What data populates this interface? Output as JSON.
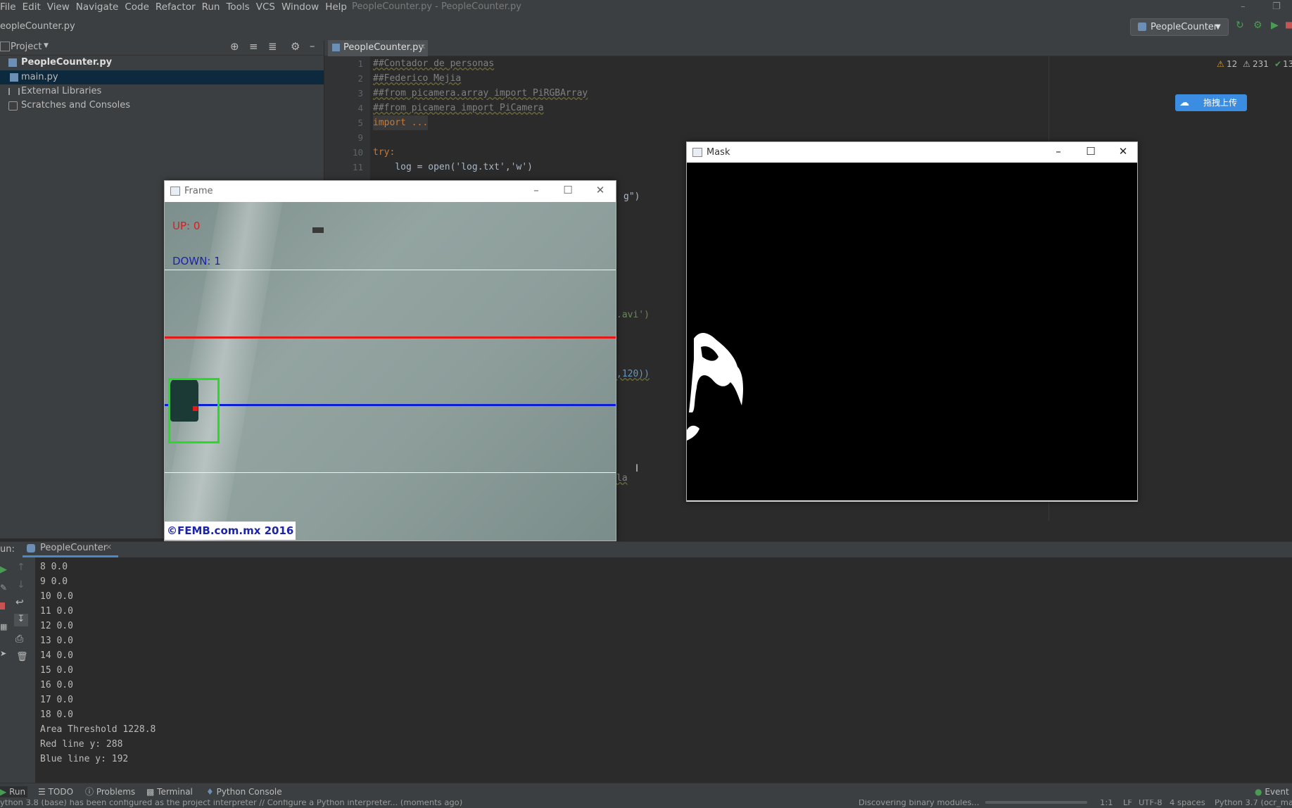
{
  "menu": [
    "File",
    "Edit",
    "View",
    "Navigate",
    "Code",
    "Refactor",
    "Run",
    "Tools",
    "VCS",
    "Window",
    "Help"
  ],
  "window_title": "PeopleCounter.py - PeopleCounter.py",
  "nav_file": "eopleCounter.py",
  "run_config": "PeopleCounter",
  "project": {
    "header": "Project",
    "items": [
      {
        "label": "PeopleCounter.py"
      },
      {
        "label": "main.py"
      },
      {
        "label": "External Libraries"
      },
      {
        "label": "Scratches and Consoles"
      }
    ]
  },
  "editor": {
    "tab": "PeopleCounter.py",
    "inspections": {
      "warnings": "12",
      "weak_warnings": "231",
      "ok": "13"
    },
    "line_numbers": [
      "1",
      "2",
      "3",
      "4",
      "5",
      "9",
      "10",
      "11"
    ],
    "lines": [
      "##Contador de personas",
      "##Federico Mejia",
      "##from picamera.array import PiRGBArray",
      "##from picamera import PiCamera",
      "import ...",
      "",
      "try:",
      "    log = open('log.txt','w')"
    ],
    "peek_fragments": [
      "g\")",
      ".avi')",
      ",120))",
      "la"
    ],
    "upload_badge": "拖拽上传"
  },
  "frame_window": {
    "title": "Frame",
    "up_label": "UP: 0",
    "down_label": "DOWN: 1",
    "watermark": "©FEMB.com.mx 2016"
  },
  "mask_window": {
    "title": "Mask"
  },
  "run_panel": {
    "run_prefix": "un:",
    "tab": "PeopleCounter",
    "console_lines": [
      "8 0.0",
      "9 0.0",
      "10 0.0",
      "11 0.0",
      "12 0.0",
      "13 0.0",
      "14 0.0",
      "15 0.0",
      "16 0.0",
      "17 0.0",
      "18 0.0",
      "Area Threshold 1228.8",
      "Red line y: 288",
      "Blue line y: 192"
    ]
  },
  "tool_windows": [
    "Run",
    "TODO",
    "Problems",
    "Terminal",
    "Python Console"
  ],
  "event_log": "Event L",
  "status": {
    "message": "ython 3.8 (base) has been configured as the project interpreter // Configure a Python interpreter... (moments ago)",
    "discovering": "Discovering binary modules...",
    "position": "1:1",
    "line_sep": "LF",
    "encoding": "UTF-8",
    "indent": "4 spaces",
    "interpreter": "Python 3.7 (ocr_ma"
  },
  "colors": {
    "red_line": "#e21a1a",
    "blue_line": "#0b1fd6",
    "bbox": "#22dd22",
    "selection": "#0d293e"
  }
}
